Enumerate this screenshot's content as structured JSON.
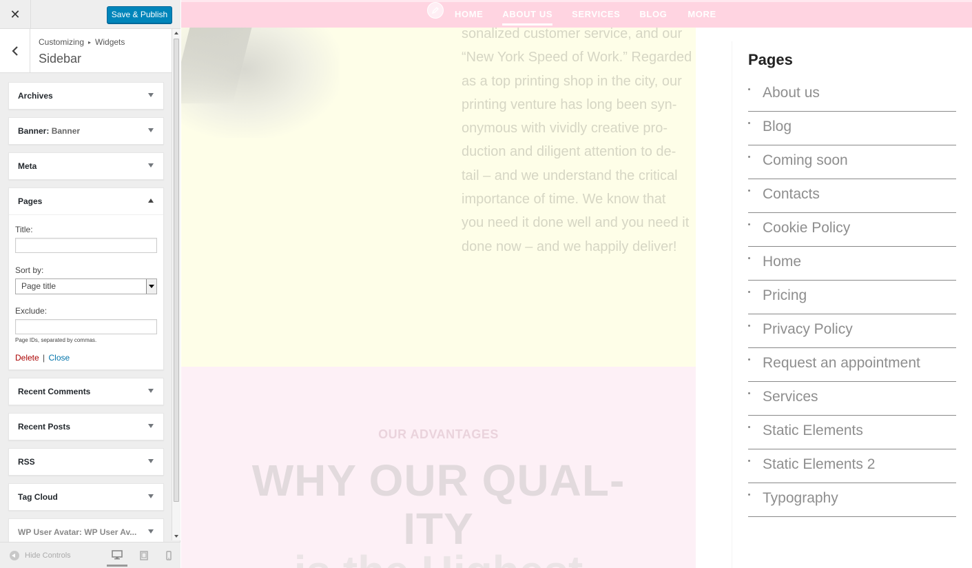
{
  "customizer": {
    "close_symbol": "✕",
    "save_label": "Save & Publish",
    "breadcrumb": {
      "root": "Customizing",
      "separator": "▸",
      "current": "Widgets"
    },
    "section_title": "Sidebar",
    "widgets": [
      {
        "title": "Archives",
        "subtitle": "",
        "expanded": false
      },
      {
        "title": "Banner:",
        "subtitle": "Banner",
        "expanded": false
      },
      {
        "title": "Meta",
        "subtitle": "",
        "expanded": false
      },
      {
        "title": "Pages",
        "subtitle": "",
        "expanded": true
      },
      {
        "title": "Recent Comments",
        "subtitle": "",
        "expanded": false
      },
      {
        "title": "Recent Posts",
        "subtitle": "",
        "expanded": false
      },
      {
        "title": "RSS",
        "subtitle": "",
        "expanded": false
      },
      {
        "title": "Tag Cloud",
        "subtitle": "",
        "expanded": false
      },
      {
        "title": "WP User Avatar:",
        "subtitle": "WP User Av...",
        "expanded": false
      }
    ],
    "pages_form": {
      "title_label": "Title:",
      "title_value": "",
      "sort_label": "Sort by:",
      "sort_value": "Page title",
      "exclude_label": "Exclude:",
      "exclude_value": "",
      "exclude_help": "Page IDs, separated by commas.",
      "delete_label": "Delete",
      "separator": "|",
      "close_label": "Close"
    },
    "footer": {
      "hide_controls_label": "Hide Controls",
      "devices": [
        "desktop-icon",
        "tablet-icon",
        "mobile-icon"
      ],
      "active_device": "desktop"
    }
  },
  "preview": {
    "nav": {
      "items": [
        "HOME",
        "ABOUT US",
        "SERVICES",
        "BLOG",
        "MORE"
      ],
      "active": "ABOUT US",
      "edit_icon": "pencil-icon"
    },
    "hero_lines": [
      "sonalized customer service, and our",
      "“New York Speed of Work.” Regarded",
      "as a top printing shop in the city, our",
      "printing venture has long been syn-",
      "onymous with vividly creative pro-",
      "duction and diligent attention to de-",
      "tail – and we understand the critical",
      "importance of time. We know that",
      "you need it done well and you need it",
      "done now – and we happily deliver!"
    ],
    "advantages_label": "OUR ADVANTAGES",
    "why_title_line1": "WHY OUR QUAL-",
    "why_title_line2": "ITY",
    "why_title_line3": "is the Highest",
    "sidebar": {
      "title": "Pages",
      "pages": [
        "About us",
        "Blog",
        "Coming soon",
        "Contacts",
        "Cookie Policy",
        "Home",
        "Pricing",
        "Privacy Policy",
        "Request an appointment",
        "Services",
        "Static Elements",
        "Static Elements 2",
        "Typography"
      ]
    }
  },
  "colors": {
    "accent": "#0085ba",
    "nav_bg": "#ffd4e1",
    "hero_bg": "#fefee8",
    "pink_section_bg": "#fdf0f6",
    "delete_link": "#aa0000",
    "close_link": "#0073aa"
  }
}
